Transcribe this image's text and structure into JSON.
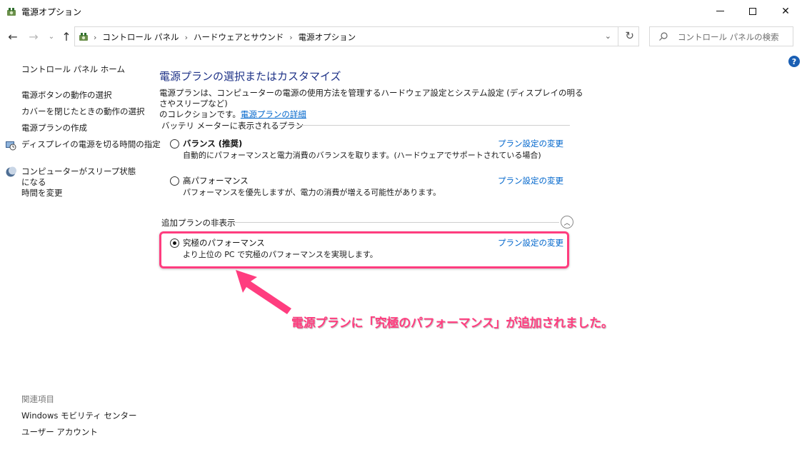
{
  "window": {
    "title": "電源オプション",
    "controls": {
      "minimize_icon": "minimize-icon",
      "maximize_icon": "maximize-icon",
      "close_label": "✕"
    }
  },
  "nav": {
    "back": "←",
    "forward": "→",
    "recent": "⌄",
    "up": "↑",
    "breadcrumb": [
      "コントロール パネル",
      "ハードウェアとサウンド",
      "電源オプション"
    ],
    "separator": "›",
    "dropdown": "⌄",
    "refresh": "↻"
  },
  "search": {
    "placeholder": "コントロール パネルの検索"
  },
  "help": {
    "label": "?"
  },
  "sidebar": {
    "home": "コントロール パネル ホーム",
    "tasks": [
      {
        "label": "電源ボタンの動作の選択",
        "icon": null
      },
      {
        "label": "カバーを閉じたときの動作の選択",
        "icon": null
      },
      {
        "label": "電源プランの作成",
        "icon": null
      },
      {
        "label": "ディスプレイの電源を切る時間の指定",
        "icon": "display-clock-icon"
      },
      {
        "label": "コンピューターがスリープ状態になる",
        "label2": "時間を変更",
        "icon": "moon-icon"
      }
    ],
    "related_title": "関連項目",
    "related": [
      "Windows モビリティ センター",
      "ユーザー アカウント"
    ]
  },
  "main": {
    "title": "電源プランの選択またはカスタマイズ",
    "description_line1": "電源プランは、コンピューターの電源の使用方法を管理するハードウェア設定とシステム設定 (ディスプレイの明るさやスリープなど)",
    "description_line2": "のコレクションです。",
    "description_link": "電源プランの詳細",
    "battery_section": "バッテリ メーターに表示されるプラン",
    "hidden_section": "追加プランの非表示",
    "plans": [
      {
        "name": "バランス (推奨)",
        "desc": "自動的にパフォーマンスと電力消費のバランスを取ります。(ハードウェアでサポートされている場合)",
        "link": "プラン設定の変更",
        "selected": false,
        "bold": true
      },
      {
        "name": "高パフォーマンス",
        "desc": "パフォーマンスを優先しますが、電力の消費が増える可能性があります。",
        "link": "プラン設定の変更",
        "selected": false,
        "bold": false
      },
      {
        "name": "究極のパフォーマンス",
        "desc": "より上位の PC で究極のパフォーマンスを実現します。",
        "link": "プラン設定の変更",
        "selected": true,
        "bold": false
      }
    ],
    "collapse": "︿"
  },
  "annotation": {
    "text": "電源プランに「究極のパフォーマンス」が追加されました。",
    "color": "#ff3d7f"
  }
}
